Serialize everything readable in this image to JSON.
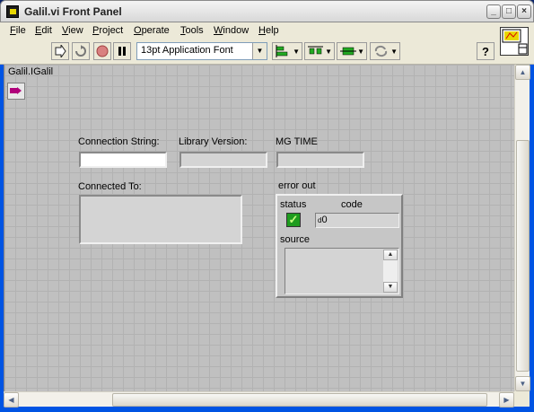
{
  "window": {
    "title": "Galil.vi Front Panel",
    "controls": [
      "_",
      "□",
      "×"
    ]
  },
  "menu": [
    {
      "label": "File",
      "mnemonic": "F",
      "rest": "ile"
    },
    {
      "label": "Edit",
      "mnemonic": "E",
      "rest": "dit"
    },
    {
      "label": "View",
      "mnemonic": "V",
      "rest": "iew"
    },
    {
      "label": "Project",
      "mnemonic": "P",
      "rest": "roject"
    },
    {
      "label": "Operate",
      "mnemonic": "O",
      "rest": "perate"
    },
    {
      "label": "Tools",
      "mnemonic": "T",
      "rest": "ools"
    },
    {
      "label": "Window",
      "mnemonic": "W",
      "rest": "indow"
    },
    {
      "label": "Help",
      "mnemonic": "H",
      "rest": "elp"
    }
  ],
  "toolbar": {
    "font_select": "13pt Application Font",
    "help_label": "?",
    "buttons": [
      "run-arrow-icon",
      "run-continuous-icon",
      "abort-icon",
      "pause-icon"
    ],
    "dropdowns": [
      "align-objects-icon",
      "distribute-objects-icon",
      "resize-objects-icon",
      "reorder-icon"
    ]
  },
  "panel": {
    "galil_label": "Galil.IGalil",
    "connection_string_label": "Connection String:",
    "connection_string_value": "",
    "library_version_label": "Library Version:",
    "library_version_value": "",
    "mg_time_label": "MG TIME",
    "mg_time_value": "",
    "connected_to_label": "Connected To:",
    "connected_to_value": "",
    "error_out": {
      "label": "error out",
      "status_label": "status",
      "status_checked": true,
      "code_label": "code",
      "code_value": "0",
      "source_label": "source",
      "source_value": ""
    }
  },
  "colors": {
    "panel_bg": "#c0c0c0",
    "grid": "#b2b2b2",
    "status_green": "#1e9c1e"
  }
}
